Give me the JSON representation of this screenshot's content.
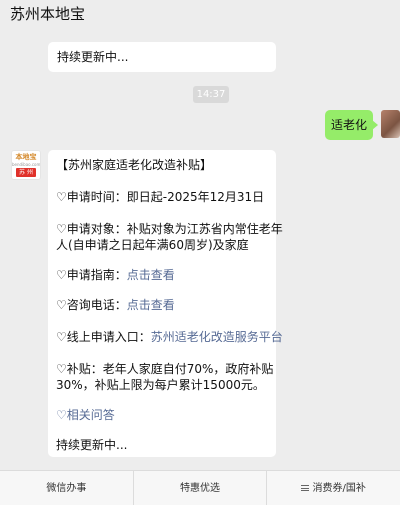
{
  "header": {
    "title": "苏州本地宝",
    "more_icon": "more-dots-icon"
  },
  "messages": {
    "top_text": "持续更新中...",
    "time": "14:37",
    "my_text": "适老化",
    "avatar": {
      "brand": "本地宝",
      "sub": "bendibao.com",
      "city": "苏 州"
    }
  },
  "article": {
    "title": "【苏州家庭适老化改造补贴】",
    "time_label": "♡申请时间：",
    "time_value": "即日起-2025年12月31日",
    "target_line1": "♡申请对象：补贴对象为江苏省内常住老年",
    "target_line2": "人(自申请之日起年满60周岁)及家庭",
    "guide_label": "♡申请指南：",
    "guide_link": "点击查看",
    "phone_label": "♡咨询电话：",
    "phone_link": "点击查看",
    "online_label": "♡线上申请入口：",
    "online_link": "苏州适老化改造服务平台",
    "subsidy_line1": "♡补贴：老年人家庭自付70%，政府补贴",
    "subsidy_line2": "30%，补贴上限为每户累计15000元。",
    "faq_link": "♡相关问答",
    "footer": "持续更新中..."
  },
  "tabbar": {
    "tab1": "微信办事",
    "tab2": "特惠优选",
    "tab3": "消费券/国补"
  }
}
